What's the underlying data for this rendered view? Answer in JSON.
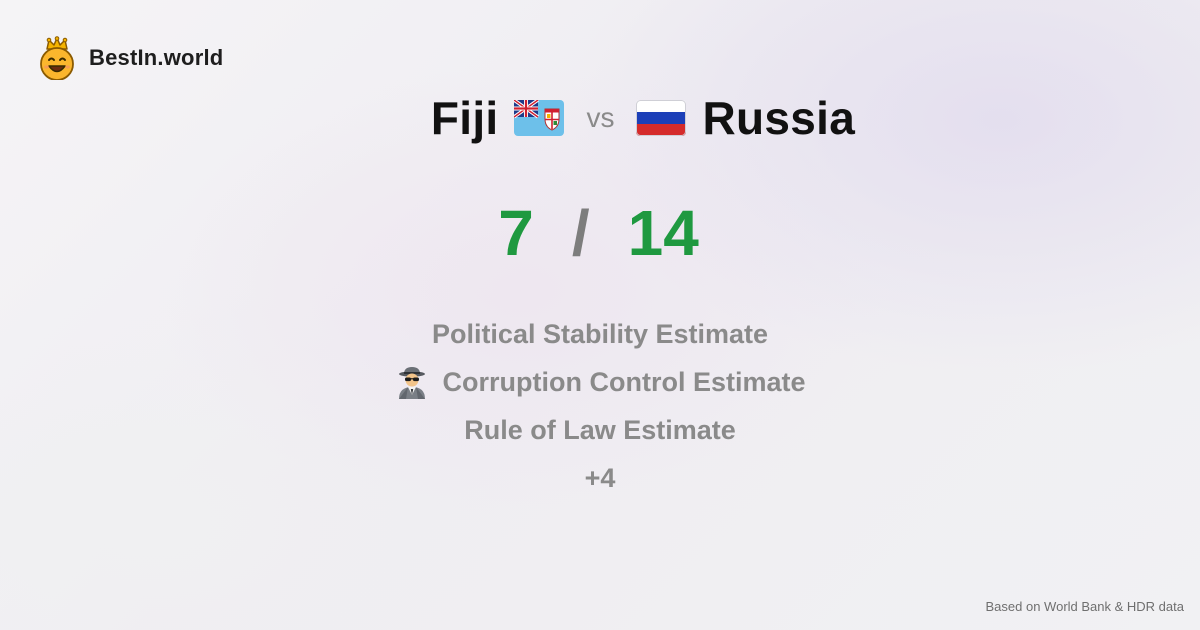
{
  "brand": {
    "name": "BestIn.world",
    "logo_icon": "crowned-smiley-icon"
  },
  "comparison": {
    "left_country": "Fiji",
    "left_flag_icon": "fiji-flag-icon",
    "vs_label": "vs",
    "right_country": "Russia",
    "right_flag_icon": "russia-flag-icon"
  },
  "score": {
    "left": "7",
    "separator": "/",
    "right": "14",
    "color": "#1f9940"
  },
  "metrics": [
    {
      "label": "Political Stability Estimate",
      "icon": ""
    },
    {
      "label": "Corruption Control Estimate",
      "icon": "spy-icon"
    },
    {
      "label": "Rule of Law Estimate",
      "icon": ""
    }
  ],
  "more_label": "+4",
  "footnote": "Based on World Bank & HDR data"
}
